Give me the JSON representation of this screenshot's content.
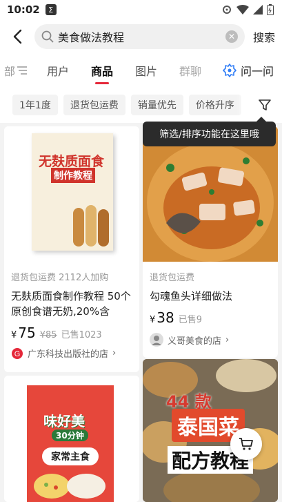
{
  "status": {
    "time": "10:02",
    "app_badge": "Σ"
  },
  "search": {
    "query": "美食做法教程",
    "button": "搜索"
  },
  "tabs": [
    {
      "label": "部"
    },
    {
      "label": "用户"
    },
    {
      "label": "商品"
    },
    {
      "label": "图片"
    },
    {
      "label": "群聊"
    }
  ],
  "ask": {
    "label": "问一问"
  },
  "filters": [
    "1年1度",
    "退货包运费",
    "销量优先",
    "价格升序"
  ],
  "tooltip": "筛选/排序功能在这里哦",
  "products": [
    {
      "cover_title": "无麸质面食",
      "cover_subtitle": "制作教程",
      "tags": "退货包运费  2112人加购",
      "title": "无麸质面食制作教程 50个原创食谱无奶,20%含",
      "currency": "¥",
      "price": "75",
      "old_price": "¥85",
      "sold": "已售1023",
      "shop": "广东科技出版社的店"
    },
    {
      "tags": "退货包运费",
      "title": "勾魂鱼头详细做法",
      "currency": "¥",
      "price": "38",
      "sold": "已售9",
      "shop": "义哥美食的店"
    },
    {
      "cover_title": "味好美",
      "cover_badge": "30分钟",
      "cover_subtitle": "家常主食"
    },
    {
      "cover_top": "44 款",
      "cover_title": "泰国菜",
      "cover_subtitle": "配方教程"
    }
  ],
  "colors": {
    "accent": "#e5283a",
    "tooltip_bg": "#2b2b2b"
  }
}
